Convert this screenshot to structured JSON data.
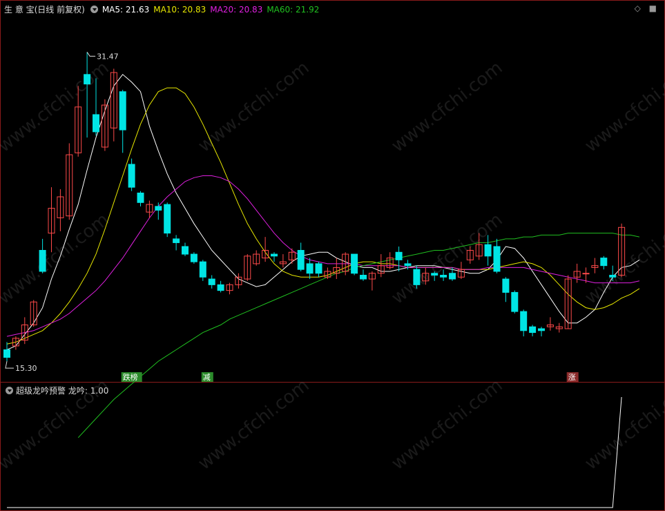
{
  "header": {
    "title": "生 意 宝(日线 前复权)",
    "ma5": "MA5: 21.63",
    "ma10": "MA10: 20.83",
    "ma20": "MA20: 20.83",
    "ma60": "MA60: 21.92"
  },
  "sub_header": {
    "title": "超级龙吟预警",
    "value": "龙吟: 1.00"
  },
  "watermark": "www.cfchi.com",
  "colors": {
    "up": "#ff4a4a",
    "down": "#00e5e5",
    "ma5": "#ffffff",
    "ma10": "#e8e800",
    "ma20": "#e020e0",
    "ma60": "#20c020",
    "border": "#8a1b1b"
  },
  "chart_data": [
    {
      "type": "candlestick",
      "ylim": [
        14.4,
        33.4
      ],
      "annotations": {
        "high_label": "31.47",
        "low_label": "15.30"
      },
      "markers": [
        {
          "label": "跌榜",
          "index": 13,
          "color": "#2a8a2a"
        },
        {
          "label": "减",
          "index": 22,
          "color": "#2a8a2a"
        },
        {
          "label": "涨",
          "index": 63,
          "color": "#8a2a2a"
        }
      ],
      "candles": [
        [
          15.9,
          15.5,
          16.3,
          15.3
        ],
        [
          16.1,
          16.5,
          16.6,
          15.9
        ],
        [
          16.4,
          17.2,
          17.6,
          16.2
        ],
        [
          17.2,
          18.4,
          18.5,
          17.1
        ],
        [
          21.1,
          20.0,
          21.7,
          19.9
        ],
        [
          22.0,
          23.3,
          24.4,
          21.0
        ],
        [
          22.8,
          23.9,
          24.3,
          22.1
        ],
        [
          22.9,
          26.1,
          26.7,
          22.7
        ],
        [
          26.2,
          28.6,
          29.7,
          26.0
        ],
        [
          30.3,
          29.8,
          31.47,
          27.0
        ],
        [
          28.2,
          27.3,
          30.1,
          27.1
        ],
        [
          26.5,
          28.7,
          29.0,
          26.3
        ],
        [
          27.5,
          30.4,
          30.6,
          26.8
        ],
        [
          29.4,
          27.4,
          29.5,
          26.2
        ],
        [
          25.6,
          24.4,
          25.9,
          24.2
        ],
        [
          24.1,
          23.6,
          24.2,
          23.4
        ],
        [
          23.1,
          23.5,
          23.7,
          22.8
        ],
        [
          23.4,
          23.2,
          23.6,
          22.7
        ],
        [
          23.5,
          22.0,
          23.6,
          21.8
        ],
        [
          21.7,
          21.5,
          21.9,
          21.1
        ],
        [
          21.3,
          20.9,
          21.5,
          20.8
        ],
        [
          20.9,
          20.5,
          21.0,
          20.4
        ],
        [
          20.5,
          19.7,
          20.6,
          19.5
        ],
        [
          19.6,
          19.3,
          19.8,
          19.1
        ],
        [
          19.3,
          19.0,
          19.5,
          18.9
        ],
        [
          19.0,
          19.3,
          19.4,
          18.8
        ],
        [
          19.3,
          19.7,
          19.9,
          19.1
        ],
        [
          19.6,
          20.8,
          20.9,
          19.5
        ],
        [
          20.4,
          20.9,
          21.1,
          20.3
        ],
        [
          20.7,
          21.1,
          21.8,
          20.5
        ],
        [
          20.9,
          20.8,
          21.0,
          20.5
        ],
        [
          20.4,
          20.5,
          20.9,
          20.2
        ],
        [
          20.6,
          21.0,
          21.2,
          20.4
        ],
        [
          21.1,
          20.1,
          21.5,
          20.0
        ],
        [
          20.4,
          19.9,
          20.7,
          19.6
        ],
        [
          20.4,
          19.9,
          20.5,
          19.7
        ],
        [
          19.7,
          20.0,
          20.2,
          19.6
        ],
        [
          19.9,
          20.2,
          20.7,
          19.6
        ],
        [
          20.0,
          20.9,
          21.0,
          19.8
        ],
        [
          20.9,
          19.9,
          20.9,
          19.8
        ],
        [
          19.8,
          19.6,
          20.1,
          19.5
        ],
        [
          19.6,
          19.9,
          20.0,
          19.0
        ],
        [
          19.9,
          20.3,
          20.9,
          19.7
        ],
        [
          20.2,
          20.7,
          21.0,
          20.1
        ],
        [
          21.0,
          20.6,
          21.3,
          20.0
        ],
        [
          20.4,
          20.3,
          20.6,
          20.1
        ],
        [
          20.1,
          19.3,
          20.3,
          19.1
        ],
        [
          19.5,
          19.9,
          20.2,
          19.3
        ],
        [
          19.9,
          19.8,
          20.0,
          19.5
        ],
        [
          19.8,
          19.7,
          20.1,
          19.5
        ],
        [
          19.9,
          19.6,
          20.2,
          19.5
        ],
        [
          19.7,
          20.1,
          20.5,
          19.6
        ],
        [
          20.6,
          21.1,
          21.3,
          20.4
        ],
        [
          20.8,
          21.4,
          22.0,
          20.6
        ],
        [
          21.4,
          20.8,
          21.9,
          20.3
        ],
        [
          21.3,
          20.0,
          21.7,
          19.9
        ],
        [
          19.6,
          18.9,
          19.7,
          18.4
        ],
        [
          18.9,
          17.9,
          19.0,
          17.8
        ],
        [
          17.9,
          16.9,
          18.0,
          16.6
        ],
        [
          17.1,
          16.8,
          17.2,
          16.6
        ],
        [
          17.0,
          16.9,
          17.1,
          16.6
        ],
        [
          17.1,
          17.2,
          17.6,
          16.9
        ],
        [
          17.0,
          17.1,
          17.3,
          16.8
        ],
        [
          17.0,
          19.6,
          19.8,
          17.0
        ],
        [
          19.7,
          20.0,
          20.4,
          19.4
        ],
        [
          19.9,
          19.9,
          20.2,
          19.4
        ],
        [
          20.2,
          20.3,
          20.7,
          19.9
        ],
        [
          20.7,
          20.3,
          20.8,
          20.1
        ],
        [
          19.8,
          19.7,
          20.3,
          19.5
        ],
        [
          19.8,
          22.3,
          22.5,
          19.7
        ]
      ],
      "series": [
        {
          "name": "MA5",
          "values": [
            15.9,
            16.1,
            16.7,
            17.3,
            18.1,
            19.6,
            20.8,
            22.2,
            23.5,
            25.3,
            27.0,
            28.4,
            29.7,
            30.3,
            29.9,
            29.4,
            27.6,
            26.3,
            25.1,
            24.1,
            23.3,
            22.5,
            21.8,
            21.1,
            20.6,
            20.1,
            19.6,
            19.4,
            19.2,
            19.3,
            19.7,
            20.1,
            20.5,
            20.8,
            20.9,
            21.0,
            21.0,
            20.7,
            20.5,
            20.3,
            20.2,
            20.2,
            20.0,
            20.0,
            20.1,
            20.2,
            20.3,
            20.3,
            20.3,
            20.2,
            20.1,
            20.0,
            19.9,
            19.9,
            20.1,
            20.6,
            21.3,
            21.2,
            20.7,
            20.0,
            19.3,
            18.6,
            17.9,
            17.3,
            17.3,
            17.6,
            18.0,
            18.9,
            19.7,
            20.2,
            20.3,
            20.6
          ]
        },
        {
          "name": "MA10",
          "values": [
            16.2,
            16.3,
            16.5,
            16.7,
            16.9,
            17.3,
            17.8,
            18.4,
            19.1,
            19.9,
            20.9,
            22.2,
            23.6,
            25.0,
            26.4,
            27.7,
            28.7,
            29.4,
            29.6,
            29.6,
            29.3,
            28.6,
            27.7,
            26.7,
            25.7,
            24.6,
            23.5,
            22.5,
            21.7,
            21.0,
            20.4,
            20.0,
            19.8,
            19.7,
            19.7,
            19.7,
            19.8,
            20.0,
            20.2,
            20.4,
            20.5,
            20.5,
            20.4,
            20.4,
            20.3,
            20.2,
            20.2,
            20.2,
            20.2,
            20.2,
            20.2,
            20.1,
            20.1,
            20.1,
            20.1,
            20.2,
            20.3,
            20.4,
            20.5,
            20.4,
            20.2,
            19.8,
            19.3,
            18.8,
            18.4,
            18.1,
            18.0,
            18.1,
            18.3,
            18.6,
            18.8,
            19.1
          ]
        },
        {
          "name": "MA20",
          "values": [
            16.6,
            16.7,
            16.8,
            16.9,
            17.1,
            17.3,
            17.5,
            17.8,
            18.2,
            18.6,
            19.0,
            19.5,
            20.1,
            20.7,
            21.4,
            22.1,
            22.8,
            23.4,
            23.9,
            24.3,
            24.7,
            24.9,
            25.0,
            25.0,
            24.9,
            24.7,
            24.3,
            23.8,
            23.2,
            22.6,
            22.0,
            21.5,
            21.1,
            20.8,
            20.6,
            20.5,
            20.4,
            20.4,
            20.4,
            20.4,
            20.3,
            20.3,
            20.3,
            20.3,
            20.3,
            20.2,
            20.2,
            20.2,
            20.2,
            20.2,
            20.2,
            20.1,
            20.1,
            20.1,
            20.2,
            20.2,
            20.2,
            20.2,
            20.2,
            20.1,
            20.0,
            19.9,
            19.8,
            19.7,
            19.6,
            19.5,
            19.4,
            19.4,
            19.4,
            19.4,
            19.4,
            19.5
          ]
        },
        {
          "name": "MA60",
          "values": [
            null,
            null,
            null,
            null,
            null,
            null,
            null,
            null,
            11.3,
            11.8,
            12.3,
            12.8,
            13.3,
            13.7,
            14.1,
            14.5,
            14.9,
            15.3,
            15.6,
            15.9,
            16.2,
            16.5,
            16.8,
            17.0,
            17.2,
            17.5,
            17.7,
            17.9,
            18.1,
            18.3,
            18.5,
            18.7,
            18.9,
            19.1,
            19.3,
            19.5,
            19.7,
            19.9,
            20.0,
            20.2,
            20.3,
            20.4,
            20.5,
            20.6,
            20.7,
            20.8,
            20.9,
            21.0,
            21.1,
            21.1,
            21.2,
            21.3,
            21.4,
            21.5,
            21.5,
            21.6,
            21.7,
            21.7,
            21.8,
            21.8,
            21.9,
            21.9,
            21.9,
            22.0,
            22.0,
            22.0,
            22.0,
            22.0,
            22.0,
            21.9,
            21.9,
            21.8
          ]
        }
      ]
    },
    {
      "type": "line",
      "title": "超级龙吟预警",
      "ylim": [
        0,
        1
      ],
      "series": [
        {
          "name": "龙吟",
          "values": [
            0,
            0,
            0,
            0,
            0,
            0,
            0,
            0,
            0,
            0,
            0,
            0,
            0,
            0,
            0,
            0,
            0,
            0,
            0,
            0,
            0,
            0,
            0,
            0,
            0,
            0,
            0,
            0,
            0,
            0,
            0,
            0,
            0,
            0,
            0,
            0,
            0,
            0,
            0,
            0,
            0,
            0,
            0,
            0,
            0,
            0,
            0,
            0,
            0,
            0,
            0,
            0,
            0,
            0,
            0,
            0,
            0,
            0,
            0,
            0,
            0,
            0,
            0,
            0,
            0,
            0,
            0,
            0,
            0,
            1
          ]
        }
      ]
    }
  ]
}
